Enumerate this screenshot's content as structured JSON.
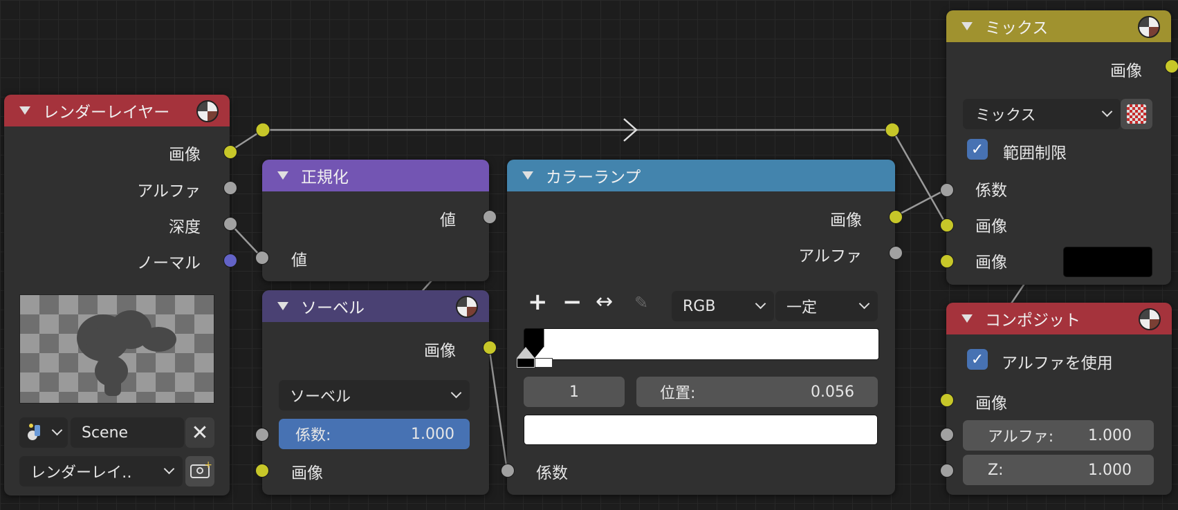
{
  "colors": {
    "render_header": "#a5333c",
    "normalize_header": "#7355b3",
    "sobel_header": "#4a4173",
    "colorramp_header": "#4384ad",
    "mix_header": "#a0922f",
    "composite_header": "#a5333c",
    "socket_image": "#c7c729",
    "socket_value": "#a1a1a1",
    "socket_vector": "#6363c7",
    "check_blue": "#4772b3"
  },
  "render_layers": {
    "title": "レンダーレイヤー",
    "outputs": [
      "画像",
      "アルファ",
      "深度",
      "ノーマル"
    ],
    "scene": "Scene",
    "layer": "レンダーレイ‥"
  },
  "normalize": {
    "title": "正規化",
    "output": "値",
    "input": "値"
  },
  "sobel": {
    "title": "ソーベル",
    "output": "画像",
    "filter_type": "ソーベル",
    "factor_label": "係数:",
    "factor_value": "1.000",
    "input": "画像"
  },
  "colorramp": {
    "title": "カラーランプ",
    "outputs": [
      "画像",
      "アルファ"
    ],
    "mode": "RGB",
    "interpolation": "一定",
    "stop_index": "1",
    "position_label": "位置:",
    "position_value": "0.056",
    "input": "係数"
  },
  "mix": {
    "title": "ミックス",
    "output": "画像",
    "blend_type": "ミックス",
    "clamp_label": "範囲制限",
    "clamp_checked": true,
    "inputs": [
      "係数",
      "画像",
      "画像"
    ]
  },
  "composite": {
    "title": "コンポジット",
    "use_alpha_label": "アルファを使用",
    "use_alpha_checked": true,
    "image_label": "画像",
    "alpha_label": "アルファ:",
    "alpha_value": "1.000",
    "z_label": "Z:",
    "z_value": "1.000"
  }
}
